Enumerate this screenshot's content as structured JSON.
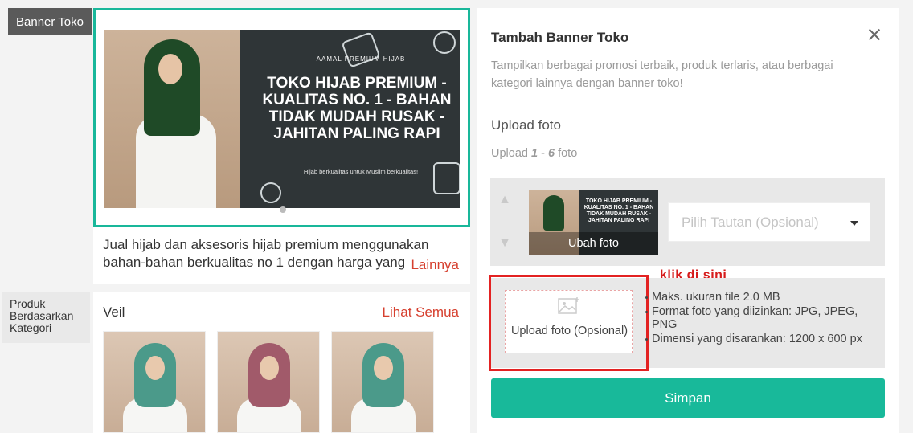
{
  "sidebar": {
    "banner_tag": "Banner Toko",
    "category_tag": "Produk Berdasarkan Kategori"
  },
  "preview": {
    "banner_subtitle": "AAMAL PREMIUM HIJAB",
    "banner_title": "TOKO HIJAB PREMIUM - KUALITAS NO. 1 - BAHAN TIDAK MUDAH RUSAK - JAHITAN PALING RAPI",
    "banner_caption": "Hijab berkualitas untuk Muslim berkualitas!",
    "description": "Jual hijab dan aksesoris hijab premium menggunakan bahan-bahan berkualitas no 1 dengan harga yang",
    "more_link": "Lainnya"
  },
  "category": {
    "title": "Veil",
    "see_all": "Lihat Semua",
    "products": [
      {
        "color": "#4b9a8a"
      },
      {
        "color": "#a15a6a"
      },
      {
        "color": "#4b9a8a"
      }
    ]
  },
  "panel": {
    "title": "Tambah Banner Toko",
    "description": "Tampilkan berbagai promosi terbaik, produk terlaris, atau berbagai kategori lainnya dengan banner toko!",
    "upload_heading": "Upload foto",
    "upload_count_prefix": "Upload",
    "upload_count_min": "1",
    "upload_count_sep": "-",
    "upload_count_max": "6",
    "upload_count_suffix": "foto",
    "thumb_text": "TOKO HIJAB PREMIUM - KUALITAS NO. 1 - BAHAN TIDAK MUDAH RUSAK - JAHITAN PALING RAPI",
    "change_photo": "Ubah foto",
    "link_placeholder": "Pilih Tautan (Opsional)",
    "upload_box_label": "Upload foto (Opsional)",
    "requirements": [
      "Maks. ukuran file 2.0 MB",
      "Format foto yang diizinkan: JPG, JPEG, PNG",
      "Dimensi yang disarankan: 1200 x 600 px"
    ],
    "hint": "klik di sini",
    "save_label": "Simpan"
  },
  "colors": {
    "accent": "#18b99a",
    "link_red": "#d6402f",
    "highlight_red": "#e32222"
  }
}
